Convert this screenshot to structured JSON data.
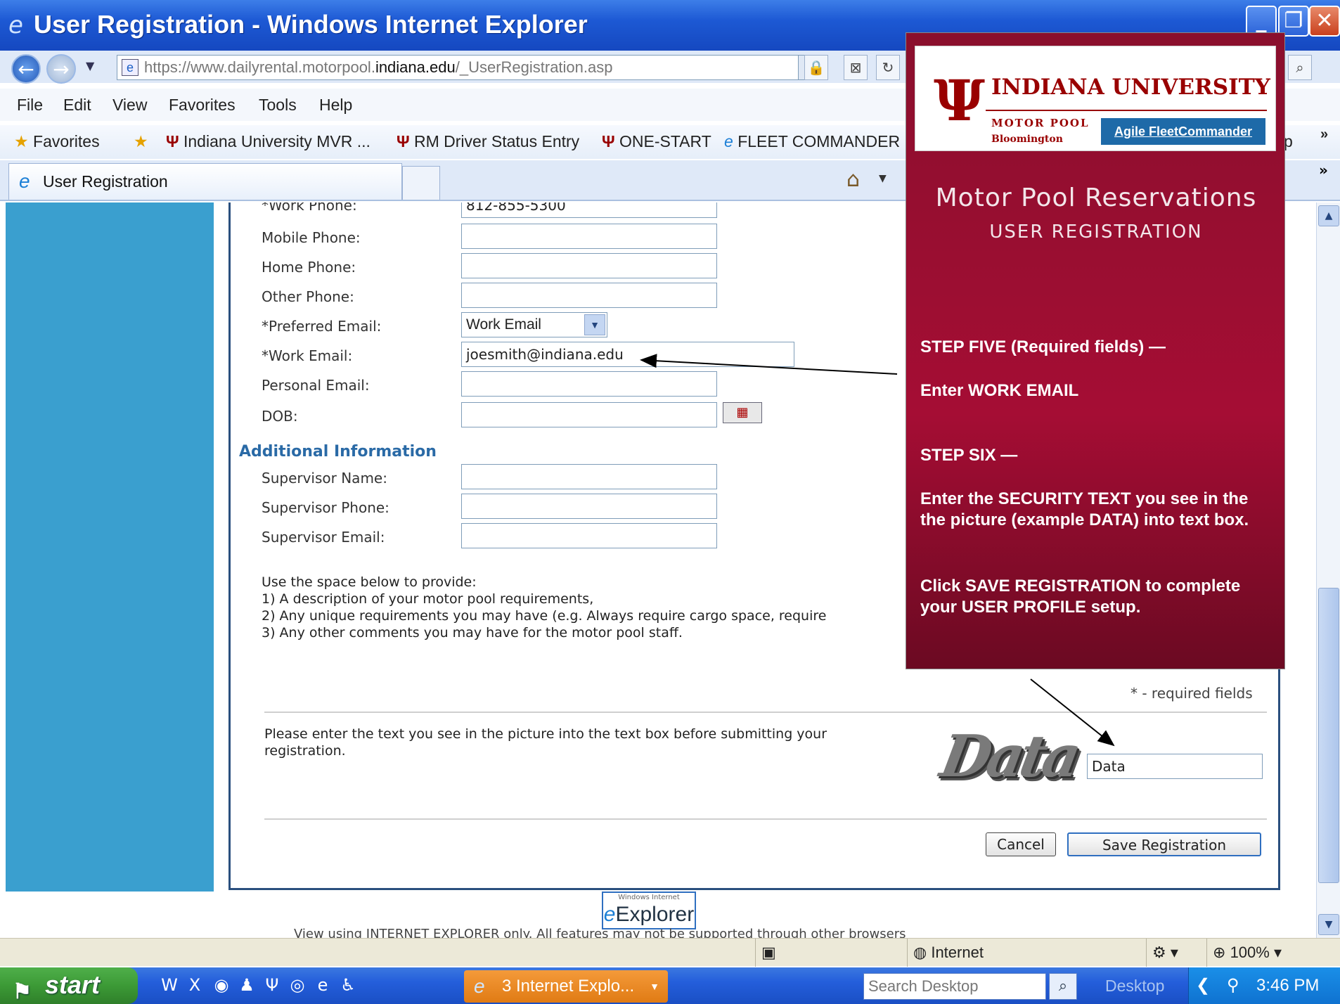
{
  "window": {
    "title": "User Registration - Windows Internet Explorer"
  },
  "addressbar": {
    "url_prefix": "https://www.dailyrental.motorpool.",
    "url_domain": "indiana.edu",
    "url_path": "/_UserRegistration.asp"
  },
  "menu": [
    "File",
    "Edit",
    "View",
    "Favorites",
    "Tools",
    "Help"
  ],
  "favorites": {
    "label": "Favorites",
    "items": [
      "Indiana University MVR ...",
      "RM Driver Status Entry",
      "ONE-START",
      "FLEET COMMANDER"
    ],
    "overflow": "p",
    "more": "»"
  },
  "tabs": {
    "active": "User Registration"
  },
  "form": {
    "partial_label": "*Work Phone:",
    "partial_value": "812-855-5300",
    "fields": [
      {
        "label": "Mobile Phone:",
        "value": ""
      },
      {
        "label": "Home Phone:",
        "value": ""
      },
      {
        "label": "Other Phone:",
        "value": ""
      }
    ],
    "preferred_email": {
      "label": "*Preferred Email:",
      "value": "Work Email"
    },
    "work_email": {
      "label": "*Work Email:",
      "value": "joesmith@indiana.edu"
    },
    "personal_email": {
      "label": "Personal Email:",
      "value": ""
    },
    "dob": {
      "label": "DOB:",
      "value": ""
    },
    "additional_heading": "Additional Information",
    "supervisor": [
      {
        "label": "Supervisor Name:",
        "value": ""
      },
      {
        "label": "Supervisor Phone:",
        "value": ""
      },
      {
        "label": "Supervisor Email:",
        "value": ""
      }
    ],
    "notes": [
      "Use the space below to provide:",
      "1) A description of your motor pool requirements,",
      "2) Any unique requirements you may have (e.g. Always require cargo space, require",
      "3) Any other comments you may have for the motor pool staff."
    ],
    "required_note": "* - required fields",
    "captcha_prompt": "Please enter the text you see in the picture into the text box before submitting your registration.",
    "captcha_image_text": "Data",
    "captcha_value": "Data",
    "cancel_label": "Cancel",
    "save_label": "Save Registration",
    "ie_badge_small": "Windows Internet",
    "ie_badge_big": "Explorer",
    "footnote": "View using INTERNET EXPLORER only.  All features may not be supported through other browsers"
  },
  "overlay": {
    "iu_name": "INDIANA UNIVERSITY",
    "motor_pool": "MOTOR POOL",
    "campus": "Bloomington",
    "agile": "Agile FleetCommander",
    "title": "Motor Pool Reservations",
    "subtitle": "USER REGISTRATION",
    "step5_head": "STEP FIVE (Required fields) —",
    "step5_body": "Enter  WORK EMAIL",
    "step6_head": "STEP SIX  —",
    "step6_body": "Enter  the SECURITY  TEXT you see in the the picture (example DATA) into text box.",
    "step6_click": "Click SAVE REGISTRATION to complete your USER PROFILE setup."
  },
  "statusbar": {
    "zone": "Internet",
    "zoom": "100%"
  },
  "taskbar": {
    "start": "start",
    "task": "3 Internet Explo...",
    "search_placeholder": "Search Desktop",
    "desktop": "Desktop",
    "clock": "3:46 PM"
  },
  "icons": [
    "ie-icon",
    "back-icon",
    "forward-icon",
    "page-icon",
    "lock-icon",
    "refresh-icon",
    "search-icon",
    "star-icon",
    "trident-icon",
    "home-icon",
    "calendar-icon",
    "windows-flag-icon"
  ],
  "colors": {
    "iu_crimson": "#990000",
    "overlay_bg": "#a50d34",
    "sidebar_blue": "#3a9fcf",
    "titlebar_blue": "#1d59d4"
  }
}
